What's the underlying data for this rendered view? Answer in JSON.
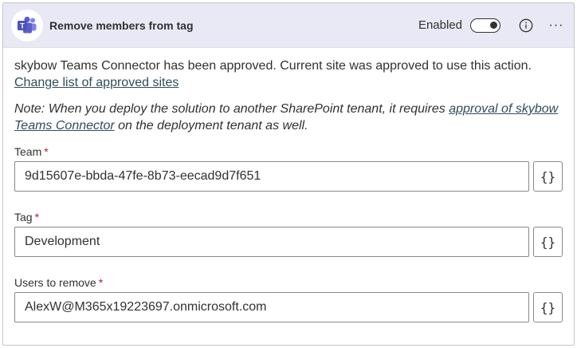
{
  "header": {
    "title": "Remove members from tag",
    "status_label": "Enabled",
    "toggle_on": true,
    "app_icon": "microsoft-teams-icon",
    "info_icon": "info-icon",
    "more_icon": "more-ellipsis-icon",
    "more_glyph": "···"
  },
  "approval": {
    "text": "skybow Teams Connector has been approved. Current site was approved to use this action.",
    "link_label": "Change list of approved sites"
  },
  "note": {
    "prefix": "Note: When you deploy the solution to another SharePoint tenant, it requires",
    "link_label": "approval of skybow Teams Connector",
    "suffix": "on the deployment tenant as well."
  },
  "fields": [
    {
      "label": "Team",
      "required_mark": "*",
      "value": "9d15607e-bbda-47fe-8b73-eecad9d7f651"
    },
    {
      "label": "Tag",
      "required_mark": "*",
      "value": "Development"
    },
    {
      "label": "Users to remove",
      "required_mark": "*",
      "value": "AlexW@M365x19223697.onmicrosoft.com"
    }
  ],
  "expression_button_glyph": "{}",
  "colors": {
    "header_bg": "#e8e9f5",
    "teams_purple": "#5b5fc7",
    "link": "#2f4d5a",
    "required": "#a4262c"
  }
}
